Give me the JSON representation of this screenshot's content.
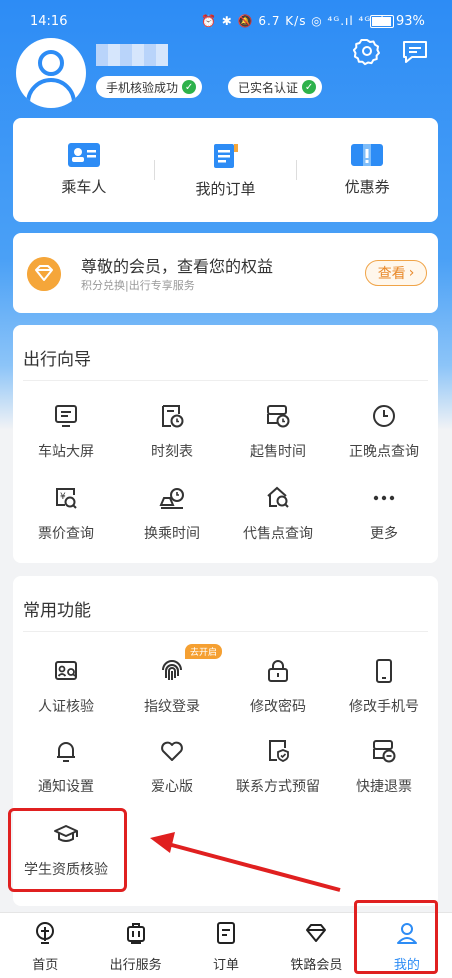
{
  "status_bar": {
    "time": "14:16",
    "indicators": "⏰ ✱  🔕 6.7 K/s ◎ ⁴ᴳ.ıl ⁴ᴳ.ıl",
    "battery": "93%"
  },
  "profile": {
    "badge_phone": "手机核验成功",
    "badge_realname": "已实名认证"
  },
  "quick_actions": [
    {
      "label": "乘车人",
      "icon": "passenger-card-icon"
    },
    {
      "label": "我的订单",
      "icon": "order-doc-icon"
    },
    {
      "label": "优惠券",
      "icon": "coupon-icon"
    }
  ],
  "member": {
    "title": "尊敬的会员，查看您的权益",
    "subtitle": "积分兑换|出行专享服务",
    "button": "查看"
  },
  "travel_guide": {
    "title": "出行向导",
    "items": [
      {
        "label": "车站大屏",
        "icon": "station-screen-icon"
      },
      {
        "label": "时刻表",
        "icon": "timetable-icon"
      },
      {
        "label": "起售时间",
        "icon": "sale-time-icon"
      },
      {
        "label": "正晚点查询",
        "icon": "clock-icon"
      },
      {
        "label": "票价查询",
        "icon": "fare-search-icon"
      },
      {
        "label": "换乘时间",
        "icon": "transfer-time-icon"
      },
      {
        "label": "代售点查询",
        "icon": "agency-search-icon"
      },
      {
        "label": "更多",
        "icon": "more-dots-icon"
      }
    ]
  },
  "common_functions": {
    "title": "常用功能",
    "tag": "去开启",
    "items": [
      {
        "label": "人证核验",
        "icon": "id-verify-icon"
      },
      {
        "label": "指纹登录",
        "icon": "fingerprint-icon"
      },
      {
        "label": "修改密码",
        "icon": "lock-icon"
      },
      {
        "label": "修改手机号",
        "icon": "phone-icon"
      },
      {
        "label": "通知设置",
        "icon": "bell-icon"
      },
      {
        "label": "爱心版",
        "icon": "heart-icon"
      },
      {
        "label": "联系方式预留",
        "icon": "contact-reserve-icon"
      },
      {
        "label": "快捷退票",
        "icon": "quick-refund-icon"
      },
      {
        "label": "学生资质核验",
        "icon": "graduation-cap-icon"
      }
    ]
  },
  "tabbar": [
    {
      "label": "首页",
      "icon": "home-train-icon"
    },
    {
      "label": "出行服务",
      "icon": "luggage-icon"
    },
    {
      "label": "订单",
      "icon": "order-icon"
    },
    {
      "label": "铁路会员",
      "icon": "diamond-icon"
    },
    {
      "label": "我的",
      "icon": "user-icon"
    }
  ],
  "colors": {
    "primary": "#2d8cf5",
    "accent": "#f5a63a",
    "highlight": "#e02020"
  }
}
